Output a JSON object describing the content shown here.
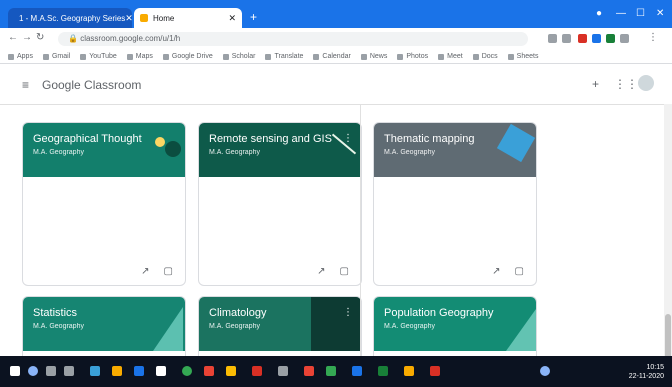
{
  "browser": {
    "tabs": [
      {
        "label": "1 - M.A.Sc. Geography Series",
        "active": false
      },
      {
        "label": "Home",
        "active": true
      }
    ],
    "url": "classroom.google.com/u/1/h",
    "bookmarks": [
      "Apps",
      "Gmail",
      "YouTube",
      "Maps",
      "Google Drive",
      "Scholar",
      "Translate",
      "Calendar",
      "News",
      "Photos",
      "Meet",
      "Docs",
      "Sheets"
    ]
  },
  "app": {
    "title": "Google Classroom",
    "menu_icon": "hamburger-menu-icon"
  },
  "cards": [
    {
      "title": "Geographical Thought",
      "subtitle": "M.A. Geography",
      "color": "#137f6c"
    },
    {
      "title": "Remote sensing and GIS",
      "subtitle": "M.A. Geography",
      "color": "#0e5a4a"
    },
    {
      "title": "Thematic mapping",
      "subtitle": "M.A. Geography",
      "color": "#5f6b73"
    },
    {
      "title": "Statistics",
      "subtitle": "M.A. Geography",
      "color": "#168572"
    },
    {
      "title": "Climatology",
      "subtitle": "M.A. Geography",
      "color": "#1b7360"
    },
    {
      "title": "Population Geography",
      "subtitle": "M.A. Geography",
      "color": "#138c74"
    }
  ],
  "taskbar": {
    "time": "10:15",
    "date": "22-11-2020"
  }
}
